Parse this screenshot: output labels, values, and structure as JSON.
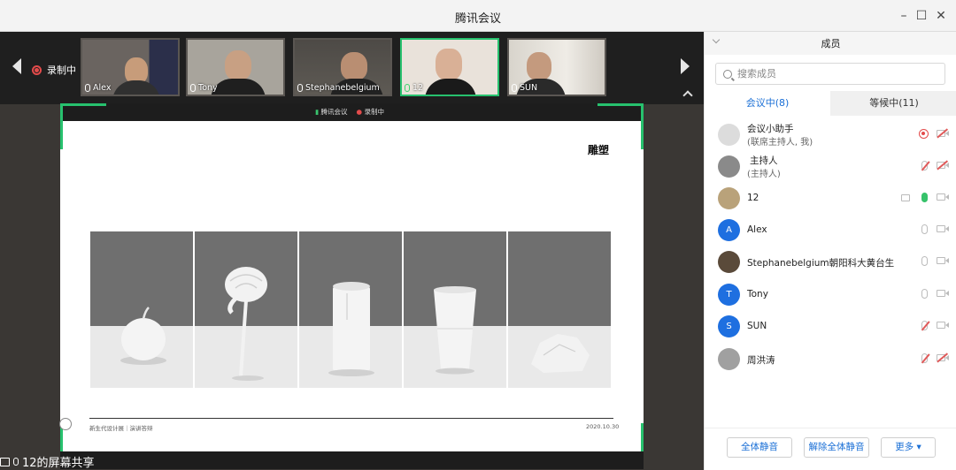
{
  "window": {
    "title": "腾讯会议"
  },
  "thumbbar": {
    "recording_label": "录制中",
    "participants": [
      {
        "name": "Alex",
        "active": false
      },
      {
        "name": "Tony",
        "active": false
      },
      {
        "name": "Stephanebelgium",
        "active": false
      },
      {
        "name": "12",
        "active": true
      },
      {
        "name": "SUN",
        "active": false
      }
    ]
  },
  "slide": {
    "strip_app": "腾讯会议",
    "strip_rec": "录制中",
    "title": "雕塑",
    "footer_left": "新生代设计展｜演讲答辩",
    "footer_right": "2020.10.30",
    "images": [
      "apple-sculpture",
      "rose-sculpture",
      "cylinder-sculpture",
      "cup-sculpture",
      "rock-sculpture"
    ]
  },
  "share_status": {
    "label": "12的屏幕共享"
  },
  "members_panel": {
    "title": "成员",
    "search_placeholder": "搜索成员",
    "tab_in_meeting": "会议中(8)",
    "tab_waiting": "等候中(11)",
    "members": [
      {
        "name": "会议小助手",
        "sub": "(联席主持人, 我)",
        "avatar_letter": "",
        "avatar_color": "#d8d8d8"
      },
      {
        "name": "主持人",
        "sub": "(主持人)",
        "avatar_letter": "",
        "avatar_color": "#8a8a8a"
      },
      {
        "name": "12",
        "sub": "",
        "avatar_letter": "",
        "avatar_color": "#b9a27a"
      },
      {
        "name": "Alex",
        "sub": "",
        "avatar_letter": "A",
        "avatar_color": "#1e6fe0"
      },
      {
        "name": "Stephanebelgium朝阳科大黄台生",
        "sub": "",
        "avatar_letter": "",
        "avatar_color": "#5a4a3a"
      },
      {
        "name": "Tony",
        "sub": "",
        "avatar_letter": "T",
        "avatar_color": "#1e6fe0"
      },
      {
        "name": "SUN",
        "sub": "",
        "avatar_letter": "S",
        "avatar_color": "#1e6fe0"
      },
      {
        "name": "周洪涛",
        "sub": "",
        "avatar_letter": "",
        "avatar_color": "#9a9a9a"
      }
    ],
    "btn_mute_all": "全体静音",
    "btn_unmute_all": "解除全体静音",
    "btn_more": "更多 ▾"
  },
  "colors": {
    "accent": "#1a6fd6",
    "active_green": "#27c16e",
    "record_red": "#e34b4b"
  }
}
